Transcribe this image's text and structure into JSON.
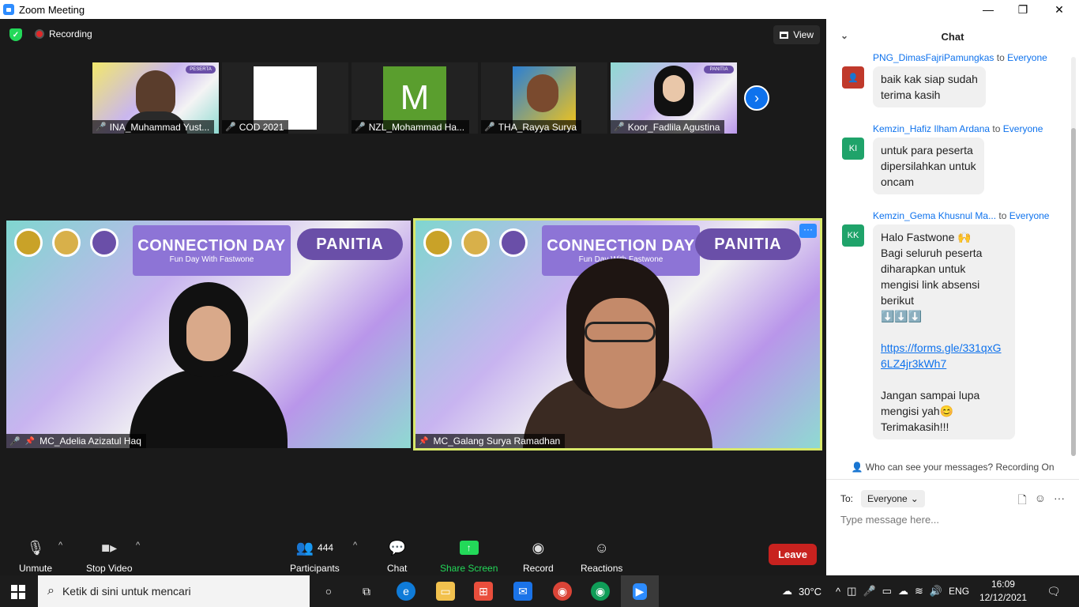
{
  "window": {
    "title": "Zoom Meeting",
    "minimize": "—",
    "maximize": "❐",
    "close": "✕"
  },
  "topbar": {
    "recording": "Recording",
    "view": "View"
  },
  "thumbnails": [
    {
      "name": "INA_Muhammad Yust..."
    },
    {
      "name": "COD 2021"
    },
    {
      "name": "NZL_Mohammad Ha..."
    },
    {
      "name": "THA_Rayya Surya"
    },
    {
      "name": "Koor_Fadlila Agustina"
    }
  ],
  "thumb_avatar_letter": "M",
  "thumb_badges": {
    "peserta": "PESERTA",
    "panitia": "PANITIA"
  },
  "tiles": [
    {
      "name": "MC_Adelia Azizatul Haq",
      "banner_title": "CONNECTION DAY",
      "banner_sub": "Fun Day With Fastwone",
      "badge": "PANITIA"
    },
    {
      "name": "MC_Galang Surya Ramadhan",
      "banner_title": "CONNECTION DAY",
      "banner_sub": "Fun Day With Fastwone",
      "badge": "PANITIA"
    }
  ],
  "toolbar": {
    "unmute": "Unmute",
    "stop_video": "Stop Video",
    "participants": "Participants",
    "participants_count": "444",
    "chat": "Chat",
    "share_screen": "Share Screen",
    "record": "Record",
    "reactions": "Reactions",
    "leave": "Leave"
  },
  "chat": {
    "title": "Chat",
    "messages": [
      {
        "sender": "PNG_DimasFajriPamungkas",
        "to_word": "to",
        "recipient": "Everyone",
        "text": "baik kak siap sudah\nterima kasih"
      },
      {
        "sender": "Kemzin_Hafiz Ilham Ardana",
        "to_word": "to",
        "recipient": "Everyone",
        "initials": "KI",
        "text": "untuk para peserta\ndipersilahkan untuk\noncam"
      },
      {
        "sender": "Kemzin_Gema Khusnul Ma...",
        "to_word": "to",
        "recipient": "Everyone",
        "initials": "KK",
        "line1": "Halo Fastwone 🙌",
        "line2": "Bagi seluruh peserta",
        "line3": "diharapkan untuk",
        "line4": "mengisi link absensi",
        "line5": "berikut",
        "line6": "⬇️⬇️⬇️",
        "link": "https://forms.gle/331qxG6LZ4jr3kWh7",
        "line7": "Jangan sampai lupa",
        "line8": "mengisi yah😊",
        "line9": "Terimakasih!!!"
      }
    ],
    "who_can_see": "Who can see your messages? Recording On",
    "to_label": "To:",
    "recipient": "Everyone",
    "input_placeholder": "Type message here..."
  },
  "taskbar": {
    "search_placeholder": "Ketik di sini untuk mencari",
    "temperature": "30°C",
    "language": "ENG",
    "time": "16:09",
    "date": "12/12/2021"
  },
  "colors": {
    "accent": "#0e72ed",
    "leave": "#c8221f",
    "share": "#23d959",
    "recording": "#e02828"
  }
}
